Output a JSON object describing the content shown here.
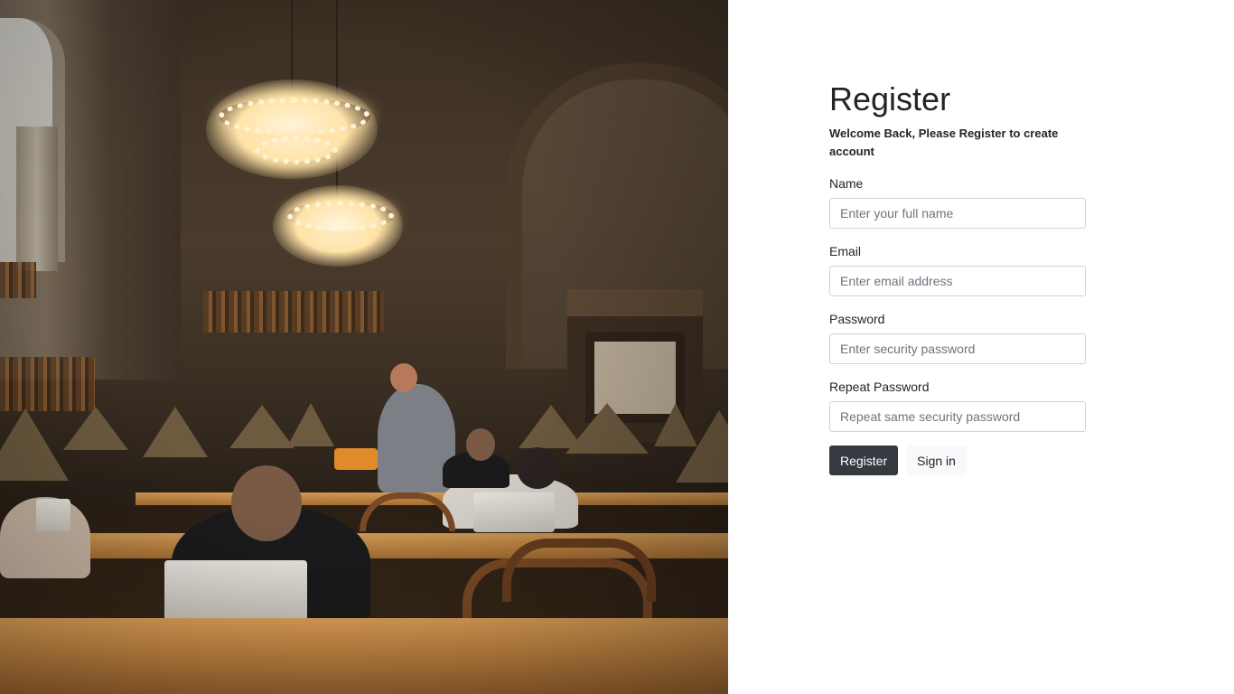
{
  "hero_image": {
    "description_icon": "library-reading-room-photo"
  },
  "form": {
    "title": "Register",
    "subtitle": "Welcome Back, Please Register to create account",
    "fields": {
      "name": {
        "label": "Name",
        "placeholder": "Enter your full name",
        "value": ""
      },
      "email": {
        "label": "Email",
        "placeholder": "Enter email address",
        "value": ""
      },
      "password": {
        "label": "Password",
        "placeholder": "Enter security password",
        "value": ""
      },
      "repeat_password": {
        "label": "Repeat Password",
        "placeholder": "Repeat same security password",
        "value": ""
      }
    },
    "buttons": {
      "register": "Register",
      "sign_in": "Sign in"
    }
  },
  "colors": {
    "primary_button": "#343a40",
    "secondary_button": "#f8f9fa",
    "input_border": "#ced4da",
    "text": "#212529"
  }
}
